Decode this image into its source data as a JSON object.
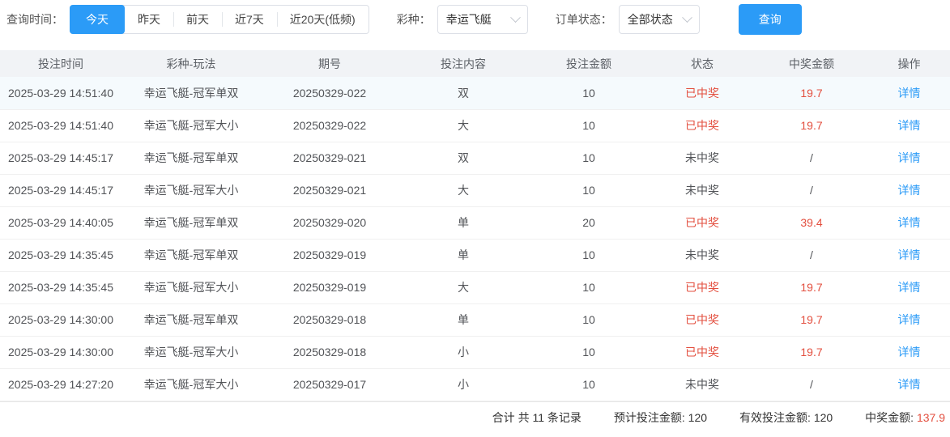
{
  "colors": {
    "accent": "#2b9bf7",
    "red": "#e34f3f"
  },
  "filter_bar": {
    "time_label": "查询时间：",
    "time_options": [
      {
        "label": "今天",
        "active": true
      },
      {
        "label": "昨天",
        "active": false
      },
      {
        "label": "前天",
        "active": false
      },
      {
        "label": "近7天",
        "active": false
      },
      {
        "label": "近20天(低频)",
        "active": false
      }
    ],
    "lottery_label": "彩种：",
    "lottery_value": "幸运飞艇",
    "status_label": "订单状态：",
    "status_value": "全部状态",
    "search_button": "查询"
  },
  "table": {
    "columns": [
      "投注时间",
      "彩种-玩法",
      "期号",
      "投注内容",
      "投注金额",
      "状态",
      "中奖金额",
      "操作"
    ],
    "action_label": "详情",
    "rows": [
      {
        "time": "2025-03-29 14:51:40",
        "game": "幸运飞艇-冠军单双",
        "issue": "20250329-022",
        "content": "双",
        "amount": "10",
        "status": "已中奖",
        "won": true,
        "win_amount": "19.7",
        "highlighted": true
      },
      {
        "time": "2025-03-29 14:51:40",
        "game": "幸运飞艇-冠军大小",
        "issue": "20250329-022",
        "content": "大",
        "amount": "10",
        "status": "已中奖",
        "won": true,
        "win_amount": "19.7",
        "highlighted": false
      },
      {
        "time": "2025-03-29 14:45:17",
        "game": "幸运飞艇-冠军单双",
        "issue": "20250329-021",
        "content": "双",
        "amount": "10",
        "status": "未中奖",
        "won": false,
        "win_amount": "/",
        "highlighted": false
      },
      {
        "time": "2025-03-29 14:45:17",
        "game": "幸运飞艇-冠军大小",
        "issue": "20250329-021",
        "content": "大",
        "amount": "10",
        "status": "未中奖",
        "won": false,
        "win_amount": "/",
        "highlighted": false
      },
      {
        "time": "2025-03-29 14:40:05",
        "game": "幸运飞艇-冠军单双",
        "issue": "20250329-020",
        "content": "单",
        "amount": "20",
        "status": "已中奖",
        "won": true,
        "win_amount": "39.4",
        "highlighted": false
      },
      {
        "time": "2025-03-29 14:35:45",
        "game": "幸运飞艇-冠军单双",
        "issue": "20250329-019",
        "content": "单",
        "amount": "10",
        "status": "未中奖",
        "won": false,
        "win_amount": "/",
        "highlighted": false
      },
      {
        "time": "2025-03-29 14:35:45",
        "game": "幸运飞艇-冠军大小",
        "issue": "20250329-019",
        "content": "大",
        "amount": "10",
        "status": "已中奖",
        "won": true,
        "win_amount": "19.7",
        "highlighted": false
      },
      {
        "time": "2025-03-29 14:30:00",
        "game": "幸运飞艇-冠军单双",
        "issue": "20250329-018",
        "content": "单",
        "amount": "10",
        "status": "已中奖",
        "won": true,
        "win_amount": "19.7",
        "highlighted": false
      },
      {
        "time": "2025-03-29 14:30:00",
        "game": "幸运飞艇-冠军大小",
        "issue": "20250329-018",
        "content": "小",
        "amount": "10",
        "status": "已中奖",
        "won": true,
        "win_amount": "19.7",
        "highlighted": false
      },
      {
        "time": "2025-03-29 14:27:20",
        "game": "幸运飞艇-冠军大小",
        "issue": "20250329-017",
        "content": "小",
        "amount": "10",
        "status": "未中奖",
        "won": false,
        "win_amount": "/",
        "highlighted": false
      }
    ]
  },
  "summary": {
    "total_records": "合计 共 11 条记录",
    "expected_label": "预计投注金额:",
    "expected_value": "120",
    "valid_label": "有效投注金额:",
    "valid_value": "120",
    "win_label": "中奖金额:",
    "win_value": "137.9"
  }
}
